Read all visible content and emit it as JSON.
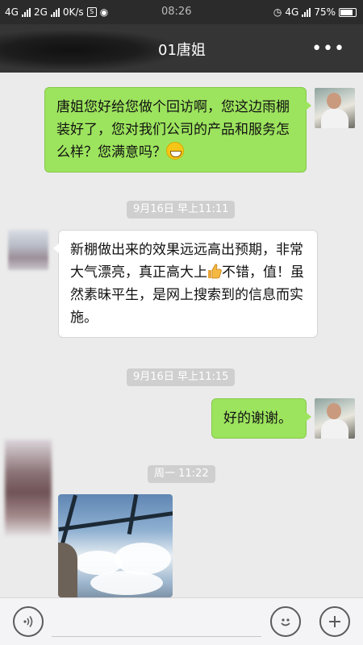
{
  "status_bar": {
    "network1": "4G",
    "network2": "2G",
    "speed": "0K/s",
    "time": "08:26",
    "network_right": "4G",
    "battery": "75%"
  },
  "chat": {
    "title": "01唐姐",
    "more_icon": "more-dots-icon"
  },
  "messages": [
    {
      "sender": "me",
      "text": "唐姐您好给您做个回访啊，您这边雨棚装好了，您对我们公司的产品和服务怎么样？您满意吗？",
      "emoji": "grin-emoji"
    },
    {
      "time": "9月16日 早上11:11"
    },
    {
      "sender": "other",
      "text_before": "新棚做出来的效果远远高出预期，非常大气漂亮，真正高大上",
      "emoji": "thumbs-up-emoji",
      "text_after": "不错，值！虽然素昧平生，是网上搜索到的信息而实施。"
    },
    {
      "time": "9月16日 早上11:15"
    },
    {
      "sender": "me",
      "text": "好的谢谢。"
    },
    {
      "time": "周一 11:22"
    },
    {
      "sender": "other",
      "type": "image"
    }
  ],
  "input_bar": {
    "voice_icon": "voice-icon",
    "emoji_icon": "emoji-icon",
    "plus_icon": "plus-icon"
  },
  "colors": {
    "bubble_me": "#9de45e",
    "bubble_other": "#ffffff",
    "background": "#ebebeb",
    "titlebar": "#353535"
  }
}
